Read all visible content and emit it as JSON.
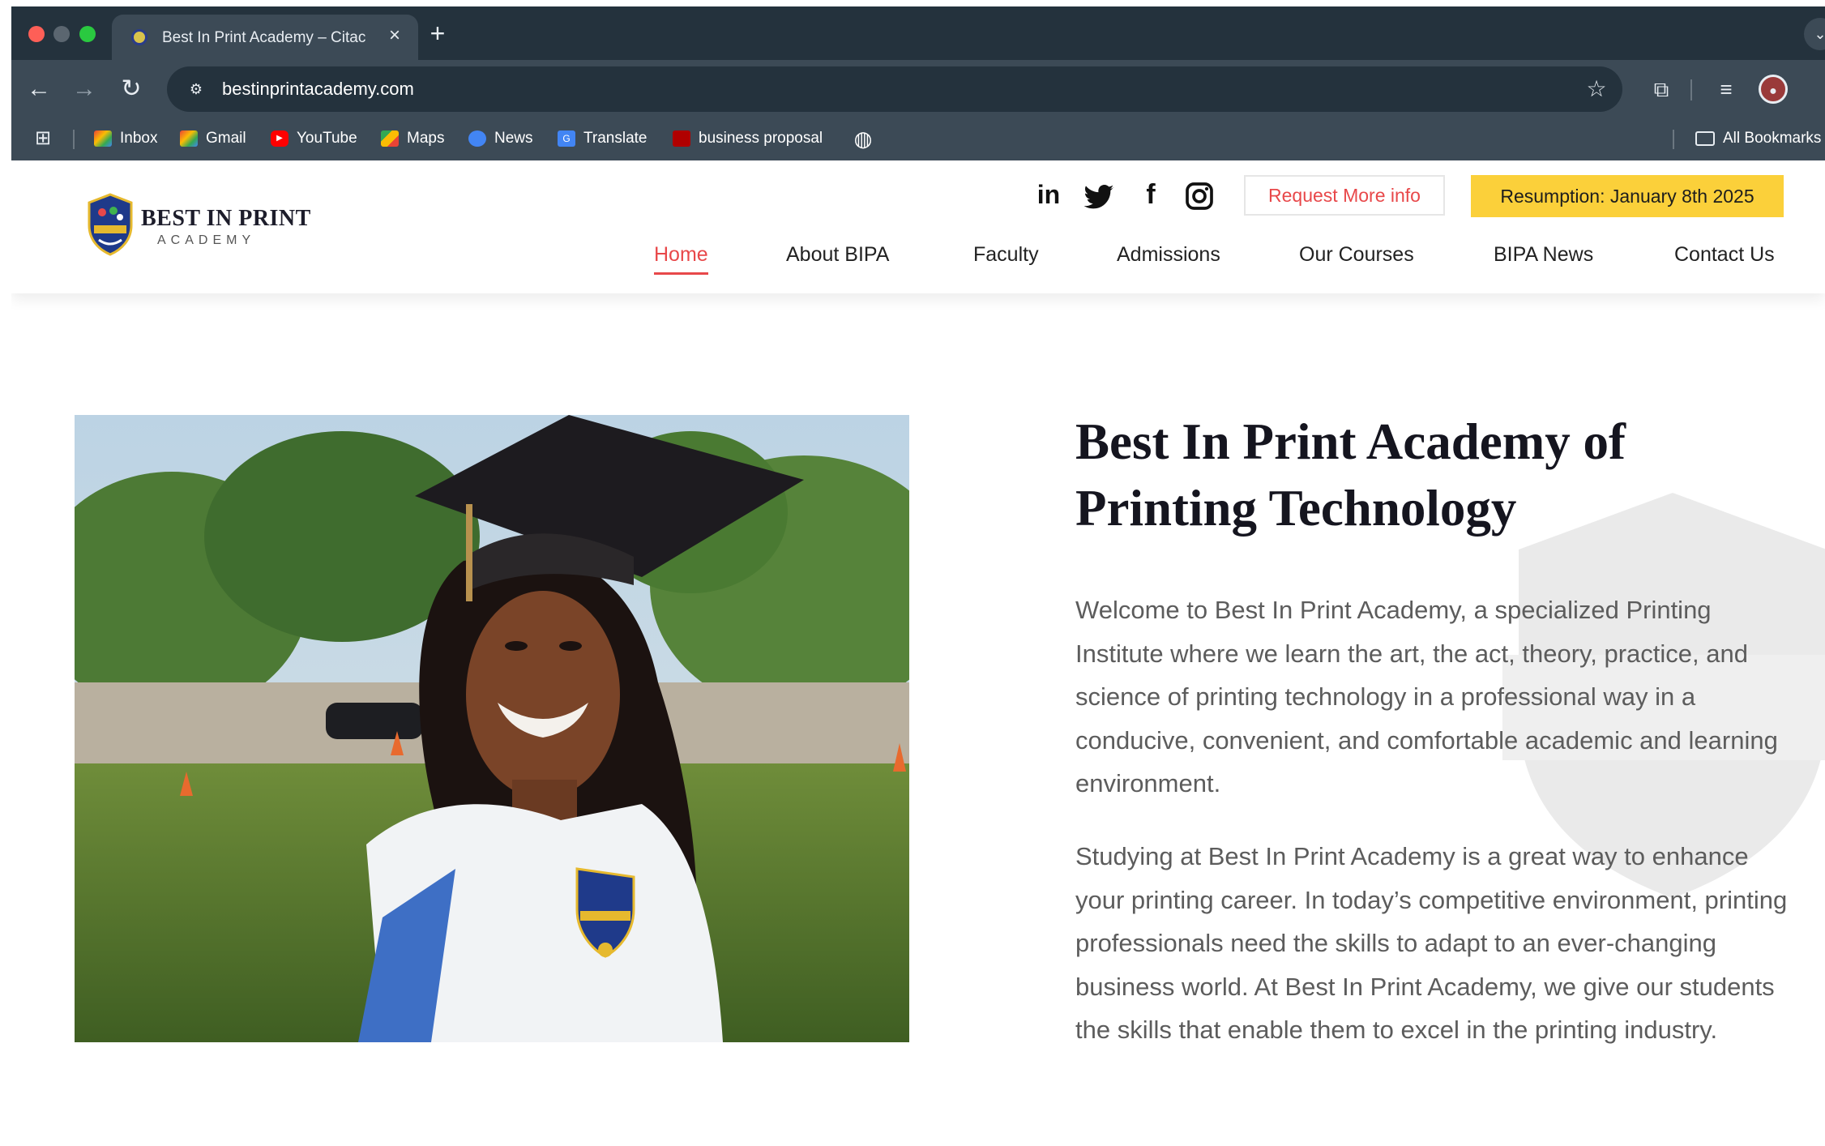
{
  "browser": {
    "tab": {
      "title": "Best In Print Academy – Citac"
    },
    "address": {
      "url": "bestinprintacademy.com"
    },
    "bookmarks": [
      {
        "label": "Inbox"
      },
      {
        "label": "Gmail"
      },
      {
        "label": "YouTube"
      },
      {
        "label": "Maps"
      },
      {
        "label": "News"
      },
      {
        "label": "Translate"
      },
      {
        "label": "business proposal"
      }
    ],
    "all_bookmarks_label": "All Bookmarks"
  },
  "site": {
    "logo": {
      "title": "BEST IN PRINT",
      "subtitle": "ACADEMY"
    },
    "social": [
      "linkedin-icon",
      "twitter-icon",
      "facebook-icon",
      "instagram-icon"
    ],
    "request_button": "Request More info",
    "resumption_button": "Resumption: January 8th 2025",
    "nav": [
      {
        "label": "Home",
        "active": true
      },
      {
        "label": "About BIPA"
      },
      {
        "label": "Faculty"
      },
      {
        "label": "Admissions"
      },
      {
        "label": "Our Courses"
      },
      {
        "label": "BIPA News"
      },
      {
        "label": "Contact Us"
      }
    ],
    "hero": {
      "heading_line1": "Best In Print Academy of",
      "heading_line2": "Printing Technology",
      "paragraph1": "Welcome to Best In Print Academy, a specialized Printing Institute where we learn the art, the act, theory, practice, and science of printing technology in a professional way in a conducive, convenient, and comfortable academic and learning environment.",
      "paragraph2": "Studying at Best In Print Academy is a great way to enhance your printing career. In today’s competitive environment, printing professionals need the skills to adapt to an ever-changing business world. At Best In Print Academy, we give our students the skills that enable them to excel in the printing industry."
    },
    "colors": {
      "accent_red": "#e8484a",
      "accent_yellow": "#fbd03a"
    }
  }
}
